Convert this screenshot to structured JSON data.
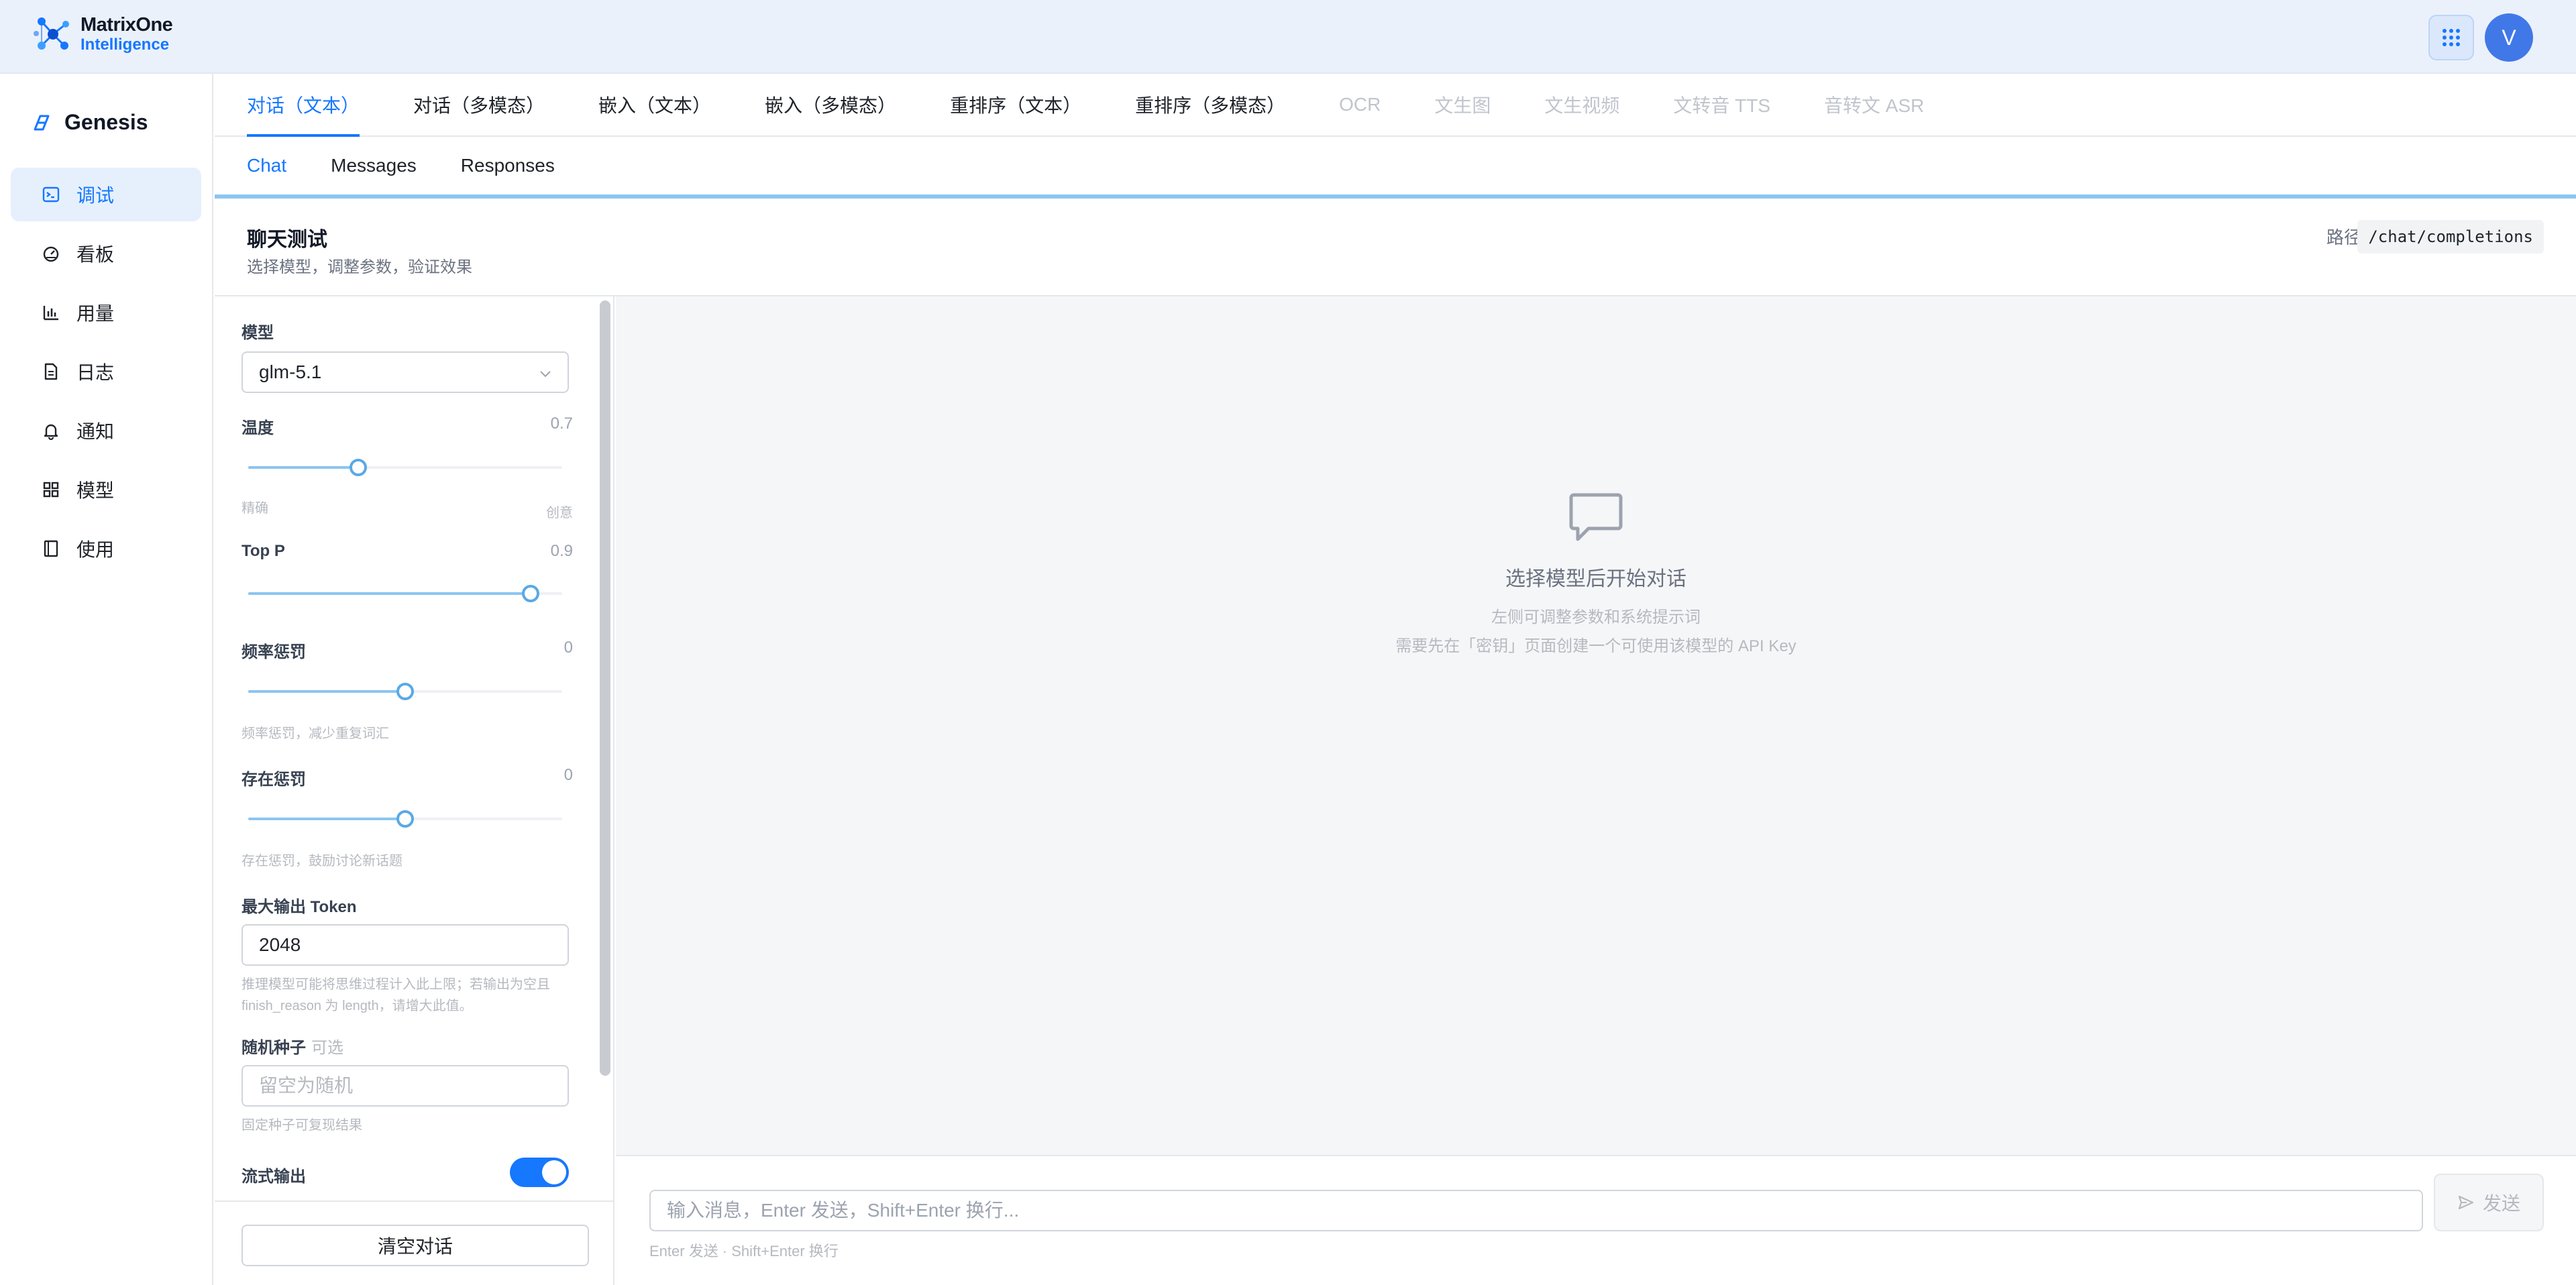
{
  "topbar": {
    "logo_line1": "MatrixOne",
    "logo_line2": "Intelligence",
    "apps_icon": "grid-dots-icon",
    "avatar_initial": "V",
    "accent": "#1677ff"
  },
  "sidebar": {
    "brand": "Genesis",
    "items": [
      {
        "label": "调试",
        "icon": "terminal-icon",
        "active": true
      },
      {
        "label": "看板",
        "icon": "gauge-icon"
      },
      {
        "label": "用量",
        "icon": "bar-chart-icon"
      },
      {
        "label": "日志",
        "icon": "document-icon"
      },
      {
        "label": "通知",
        "icon": "bell-icon"
      },
      {
        "label": "模型",
        "icon": "grid-icon"
      },
      {
        "label": "使用",
        "icon": "book-icon"
      }
    ]
  },
  "tabs": {
    "primary": [
      {
        "label": "对话（文本）",
        "active": true
      },
      {
        "label": "对话（多模态）"
      },
      {
        "label": "嵌入（文本）"
      },
      {
        "label": "嵌入（多模态）"
      },
      {
        "label": "重排序（文本）"
      },
      {
        "label": "重排序（多模态）"
      },
      {
        "label": "OCR",
        "disabled": true
      },
      {
        "label": "文生图",
        "disabled": true
      },
      {
        "label": "文生视频",
        "disabled": true
      },
      {
        "label": "文转音 TTS",
        "disabled": true
      },
      {
        "label": "音转文 ASR",
        "disabled": true
      }
    ],
    "secondary": [
      {
        "label": "Chat",
        "active": true
      },
      {
        "label": "Messages"
      },
      {
        "label": "Responses"
      }
    ]
  },
  "header": {
    "title": "聊天测试",
    "subtitle": "选择模型，调整参数，验证效果",
    "path_label": "路径",
    "path_value": "/chat/completions"
  },
  "settings": {
    "model_label": "模型",
    "model_value": "glm-5.1",
    "temperature_label": "温度",
    "temperature_value": "0.7",
    "temperature_level": 0.35,
    "temperature_min_hint": "精确",
    "temperature_max_hint": "创意",
    "top_p_label": "Top P",
    "top_p_value": "0.9",
    "top_p_level": 0.9,
    "freq_label": "频率惩罚",
    "freq_value": "0",
    "freq_level": 0.5,
    "freq_hint": "频率惩罚，减少重复词汇",
    "presence_label": "存在惩罚",
    "presence_value": "0",
    "presence_level": 0.5,
    "presence_hint": "存在惩罚，鼓励讨论新话题",
    "max_tokens_label": "最大输出 Token",
    "max_tokens_value": "2048",
    "max_tokens_hint": "推理模型可能将思维过程计入此上限；若输出为空且 finish_reason 为 length，请增大此值。",
    "seed_label": "随机种子",
    "seed_optional": "可选",
    "seed_placeholder": "留空为随机",
    "seed_hint": "固定种子可复现结果",
    "stream_label": "流式输出",
    "stream_on": true,
    "clear_button": "清空对话"
  },
  "chat": {
    "empty_icon": "chat-bubble-icon",
    "empty_title": "选择模型后开始对话",
    "empty_hint1": "左侧可调整参数和系统提示词",
    "empty_hint2": "需要先在「密钥」页面创建一个可使用该模型的 API Key",
    "input_placeholder": "输入消息，Enter 发送，Shift+Enter 换行...",
    "send_label": "发送",
    "composer_hint": "Enter 发送 · Shift+Enter 换行"
  }
}
